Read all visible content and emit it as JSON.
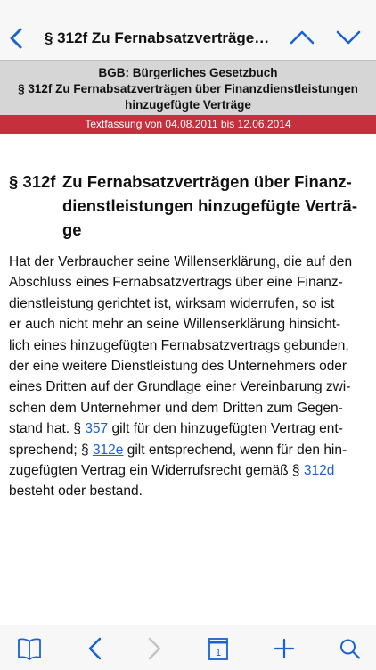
{
  "navbar": {
    "title": "§ 312f Zu Fernabsatzverträge…",
    "back_icon": "chevron-left-icon",
    "up_icon": "chevron-up-icon",
    "down_icon": "chevron-down-icon"
  },
  "header": {
    "law": "BGB: Bürgerliches Gesetzbuch",
    "section_line1": "§ 312f Zu Fernabsatzverträgen über Finanzdienstleistungen",
    "section_line2": "hinzugefügte Verträge",
    "version": "Textfassung von 04.08.2011 bis 12.06.2014"
  },
  "section": {
    "number": "§ 312f",
    "title_lines": [
      "Zu Fernabsatzverträgen über Finanz-",
      "dienstleistungen hinzugefügte Verträ-",
      "ge"
    ]
  },
  "body": {
    "lines": [
      "Hat der Verbraucher seine Willenserklärung, die auf den",
      "Abschluss eines Fernabsatzvertrags über eine Finanz-",
      "dienstleistung gerichtet ist, wirksam widerrufen, so ist",
      "er auch nicht mehr an seine Willenserklärung hinsicht-",
      "lich eines hinzugefügten Fernabsatzvertrags gebunden,",
      "der eine weitere Dienstleistung des Unternehmers oder",
      "eines Dritten auf der Grundlage einer Vereinbarung zwi-",
      "schen dem Unternehmer und dem Dritten zum Gegen-"
    ],
    "line9_before": "stand hat. § ",
    "link1": "357",
    "line9_after": " gilt für den hinzugefügten Vertrag ent-",
    "line10_before": "sprechend; § ",
    "link2": "312e",
    "line10_after": " gilt entsprechend, wenn für den hin-",
    "line11_before": "zugefügten Vertrag ein Widerrufsrecht gemäß § ",
    "link3": "312d",
    "line12": "besteht oder bestand."
  },
  "toolbar": {
    "items": [
      "book-icon",
      "back-icon",
      "forward-icon",
      "calendar-icon",
      "add-icon",
      "search-icon"
    ],
    "calendar_day": "1"
  },
  "colors": {
    "accent": "#1a62d0",
    "version_bar": "#c6303e",
    "header_bg": "#d6d6d6"
  }
}
